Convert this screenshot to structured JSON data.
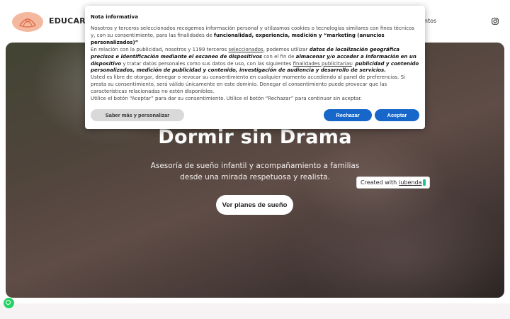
{
  "header": {
    "brand_text": "EDUCAR SI",
    "nav_partial": "entos",
    "logo_icon": "lotus-logo",
    "social_icon": "instagram-icon"
  },
  "hero": {
    "title": "Dormir sin Drama",
    "subtitle": "Asesoría de sueño infantil y acompañamiento a familias desde una mirada respetuosa y realista.",
    "button_label": "Ver planes de sueño"
  },
  "iubenda_badge": {
    "prefix": "Created with",
    "link": "iubenda"
  },
  "cookie_dialog": {
    "title": "Nota informativa",
    "p1_a": "Nosotros y terceros seleccionados recogemos información personal y utilizamos cookies o tecnologías similares con fines técnicos y, con su consentimiento, para las finalidades de ",
    "p1_b": "funcionalidad, experiencia, medición y “marketing (anuncios personalizados)”",
    "p2_a": "En relación con la publicidad, nosotros y 1199 terceros ",
    "p2_link": "seleccionados",
    "p2_b": ", podemos utilizar ",
    "p2_c": "datos de localización geográfica precisos e identificación mediante el escaneo de dispositivos",
    "p2_d": " con el fin de ",
    "p2_e": "almacenar y/o acceder a información en un dispositivo",
    "p2_f": " y tratar datos personales como sus datos de uso, con las siguientes ",
    "p2_link2": "finalidades publicitarias",
    "p2_g": ": ",
    "p2_h": "publicidad y contenido personalizados, medición de publicidad y contenido, investigación de audiencia y desarrollo de servicios.",
    "p3": "Usted es libre de otorgar, denegar o revocar su consentimiento en cualquier momento accediendo al panel de preferencias. Si presta su consentimiento, será válido únicamente en este dominio. Denegar el consentimiento puede provocar que las características relacionadas no estén disponibles.",
    "p4": "Utilice el botón “Aceptar” para dar su consentimiento. Utilice el botón “Rechazar” para continuar sin aceptar.",
    "btn_more": "Saber más y personalizar",
    "btn_reject": "Rechazar",
    "btn_accept": "Aceptar",
    "accent_color": "#1667c9"
  },
  "whatsapp_icon": "whatsapp-icon"
}
